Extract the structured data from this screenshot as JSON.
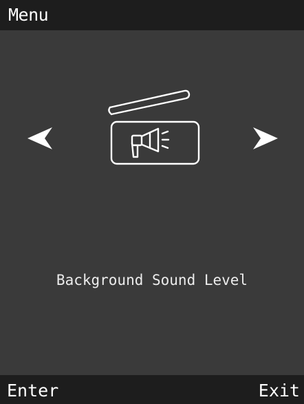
{
  "header": {
    "title": "Menu"
  },
  "menu": {
    "current_item": {
      "label": "Background Sound Level",
      "icon": "clapperboard-megaphone-icon"
    },
    "prev_icon": "arrow-left-icon",
    "next_icon": "arrow-right-icon"
  },
  "softkeys": {
    "left": "Enter",
    "right": "Exit"
  },
  "colors": {
    "bar_background": "#1d1d1d",
    "screen_background": "#3a3a3a",
    "foreground": "#ffffff"
  }
}
